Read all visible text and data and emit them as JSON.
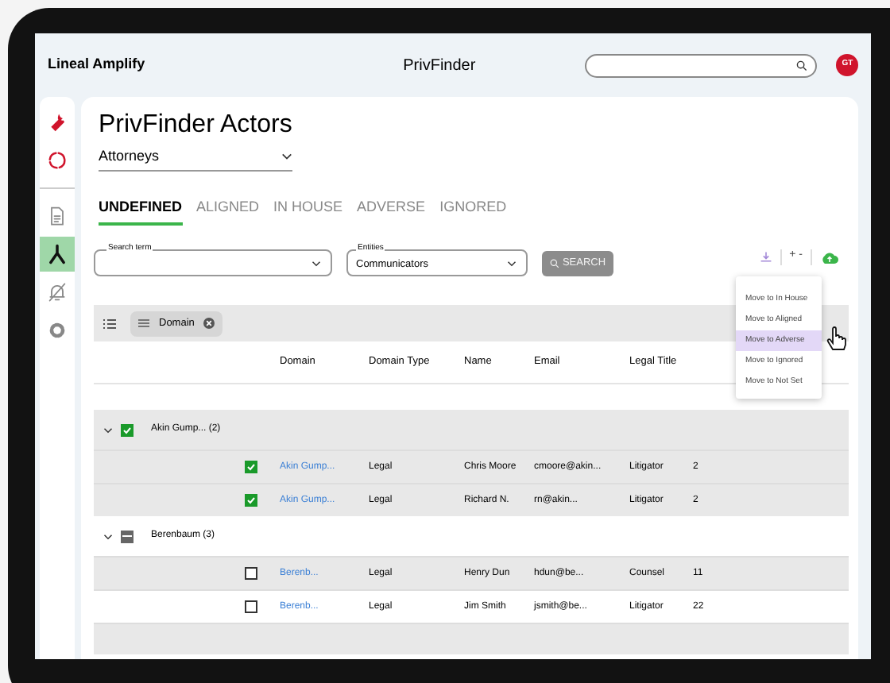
{
  "header": {
    "brand": "Lineal Amplify",
    "title": "PrivFinder",
    "avatar": "GT"
  },
  "sidebar": {
    "items": [
      {
        "selected": false
      },
      {
        "selected": false
      },
      {
        "selected": false
      },
      {
        "selected": true
      },
      {
        "selected": false
      },
      {
        "selected": false
      }
    ]
  },
  "page": {
    "title": "PrivFinder Actors",
    "dropdown": "Attorneys"
  },
  "tabs": [
    {
      "label": "UNDEFINED",
      "selected": true
    },
    {
      "label": "ALIGNED",
      "selected": false
    },
    {
      "label": "IN HOUSE",
      "selected": false
    },
    {
      "label": "ADVERSE",
      "selected": false
    },
    {
      "label": "IGNORED",
      "selected": false
    }
  ],
  "filters": {
    "search_term": {
      "label": "Search term"
    },
    "entities": {
      "label": "Entities",
      "value": "Communicators"
    },
    "search_button": {
      "label": "SEARCH",
      "disabled": true
    }
  },
  "toolbar": {
    "expand_label": "+ -"
  },
  "group_by": {
    "chip": "Domain"
  },
  "menu": {
    "items": [
      {
        "label": "Move to In House",
        "selected": false
      },
      {
        "label": "Move to Aligned",
        "selected": false
      },
      {
        "label": "Move to Adverse",
        "selected": true
      },
      {
        "label": "Move to Ignored",
        "selected": false
      },
      {
        "label": "Move to Not Set",
        "selected": false
      }
    ]
  },
  "table": {
    "columns": [
      "Domain",
      "Domain Type",
      "Name",
      "Email",
      "Legal Title"
    ],
    "groups": [
      {
        "label": "Akin Gump... (2)",
        "checked": true,
        "partial": false,
        "expanded": true,
        "rows": [
          {
            "checked": true,
            "domain": "Akin Gump...",
            "domain_type": "Legal",
            "name": "Chris Moore",
            "email": "cmoore@akin...",
            "legal_title": "Litigator",
            "column_6": "2"
          },
          {
            "checked": true,
            "domain": "Akin Gump...",
            "domain_type": "Legal",
            "name": "Richard N.",
            "email": "rn@akin...",
            "legal_title": "Litigator",
            "column_6": "2"
          }
        ]
      },
      {
        "label": "Berenbaum (3)",
        "checked": false,
        "partial": true,
        "expanded": true,
        "rows": [
          {
            "checked": false,
            "domain": "Berenb...",
            "domain_type": "Legal",
            "name": "Henry Dun",
            "email": "hdun@be...",
            "legal_title": "Counsel",
            "column_6": "11"
          },
          {
            "checked": false,
            "domain": "Berenb...",
            "domain_type": "Legal",
            "name": "Jim Smith",
            "email": "jsmith@be...",
            "legal_title": "Litigator",
            "column_6": "22"
          }
        ]
      }
    ]
  }
}
